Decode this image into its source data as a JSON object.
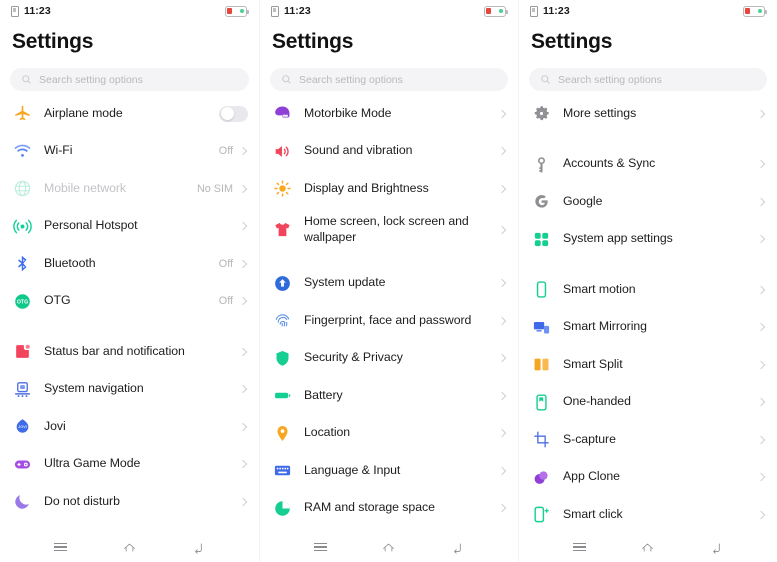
{
  "status_bar": {
    "time": "11:23",
    "sim_icon": "sim-card-icon",
    "battery_icon": "battery-low-icon"
  },
  "header": {
    "title": "Settings"
  },
  "search": {
    "placeholder": "Search setting options",
    "icon": "search-icon"
  },
  "nav_bar": {
    "recents": "recents-icon",
    "home": "home-icon",
    "back": "back-icon"
  },
  "colors": {
    "accent_orange": "#f5a623",
    "accent_blue": "#3b6cf0",
    "accent_green": "#16d099",
    "accent_red": "#f0455a",
    "accent_purple": "#9b4dd8",
    "text": "#1d1d1f",
    "muted": "#b6b6ba"
  },
  "panels": [
    {
      "id": "panel-1",
      "groups": [
        {
          "items": [
            {
              "label": "Airplane mode",
              "icon": "airplane-icon",
              "control": "toggle",
              "value": ""
            },
            {
              "label": "Wi-Fi",
              "icon": "wifi-icon",
              "control": "chevron",
              "value": "Off"
            },
            {
              "label": "Mobile network",
              "icon": "globe-icon",
              "control": "chevron",
              "value": "No SIM",
              "disabled": true
            },
            {
              "label": "Personal Hotspot",
              "icon": "hotspot-icon",
              "control": "chevron",
              "value": ""
            },
            {
              "label": "Bluetooth",
              "icon": "bluetooth-icon",
              "control": "chevron",
              "value": "Off"
            },
            {
              "label": "OTG",
              "icon": "otg-icon",
              "control": "chevron",
              "value": "Off"
            }
          ]
        },
        {
          "items": [
            {
              "label": "Status bar and notification",
              "icon": "status-bar-icon",
              "control": "chevron",
              "value": ""
            },
            {
              "label": "System navigation",
              "icon": "system-navigation-icon",
              "control": "chevron",
              "value": ""
            },
            {
              "label": "Jovi",
              "icon": "jovi-icon",
              "control": "chevron",
              "value": ""
            },
            {
              "label": "Ultra Game Mode",
              "icon": "gamepad-icon",
              "control": "chevron",
              "value": ""
            },
            {
              "label": "Do not disturb",
              "icon": "moon-icon",
              "control": "chevron",
              "value": ""
            }
          ]
        }
      ]
    },
    {
      "id": "panel-2",
      "groups": [
        {
          "items": [
            {
              "label": "Motorbike Mode",
              "icon": "helmet-icon",
              "control": "chevron",
              "value": ""
            },
            {
              "label": "Sound and vibration",
              "icon": "speaker-icon",
              "control": "chevron",
              "value": ""
            },
            {
              "label": "Display and Brightness",
              "icon": "brightness-icon",
              "control": "chevron",
              "value": ""
            },
            {
              "label": "Home screen, lock screen and wallpaper",
              "icon": "tshirt-icon",
              "control": "chevron",
              "value": "",
              "two_line": true
            }
          ]
        },
        {
          "items": [
            {
              "label": "System update",
              "icon": "system-update-icon",
              "control": "chevron",
              "value": ""
            },
            {
              "label": "Fingerprint, face and password",
              "icon": "fingerprint-icon",
              "control": "chevron",
              "value": ""
            },
            {
              "label": "Security & Privacy",
              "icon": "shield-icon",
              "control": "chevron",
              "value": ""
            },
            {
              "label": "Battery",
              "icon": "battery-icon",
              "control": "chevron",
              "value": ""
            },
            {
              "label": "Location",
              "icon": "location-pin-icon",
              "control": "chevron",
              "value": ""
            },
            {
              "label": "Language & Input",
              "icon": "keyboard-icon",
              "control": "chevron",
              "value": ""
            },
            {
              "label": "RAM and storage space",
              "icon": "pie-chart-icon",
              "control": "chevron",
              "value": ""
            },
            {
              "label": "More settings",
              "icon": "gear-icon",
              "control": "chevron",
              "value": "",
              "clipped": true
            }
          ]
        }
      ]
    },
    {
      "id": "panel-3",
      "groups": [
        {
          "items": [
            {
              "label": "More settings",
              "icon": "gear-icon",
              "control": "chevron",
              "value": ""
            }
          ]
        },
        {
          "items": [
            {
              "label": "Accounts & Sync",
              "icon": "account-key-icon",
              "control": "chevron",
              "value": ""
            },
            {
              "label": "Google",
              "icon": "google-icon",
              "control": "chevron",
              "value": ""
            },
            {
              "label": "System app settings",
              "icon": "apps-grid-icon",
              "control": "chevron",
              "value": ""
            }
          ]
        },
        {
          "items": [
            {
              "label": "Smart motion",
              "icon": "smart-motion-icon",
              "control": "chevron",
              "value": ""
            },
            {
              "label": "Smart Mirroring",
              "icon": "smart-mirroring-icon",
              "control": "chevron",
              "value": ""
            },
            {
              "label": "Smart Split",
              "icon": "smart-split-icon",
              "control": "chevron",
              "value": ""
            },
            {
              "label": "One-handed",
              "icon": "one-handed-icon",
              "control": "chevron",
              "value": ""
            },
            {
              "label": "S-capture",
              "icon": "s-capture-icon",
              "control": "chevron",
              "value": ""
            },
            {
              "label": "App Clone",
              "icon": "app-clone-icon",
              "control": "chevron",
              "value": ""
            },
            {
              "label": "Smart click",
              "icon": "smart-click-icon",
              "control": "chevron",
              "value": ""
            }
          ]
        }
      ]
    }
  ]
}
